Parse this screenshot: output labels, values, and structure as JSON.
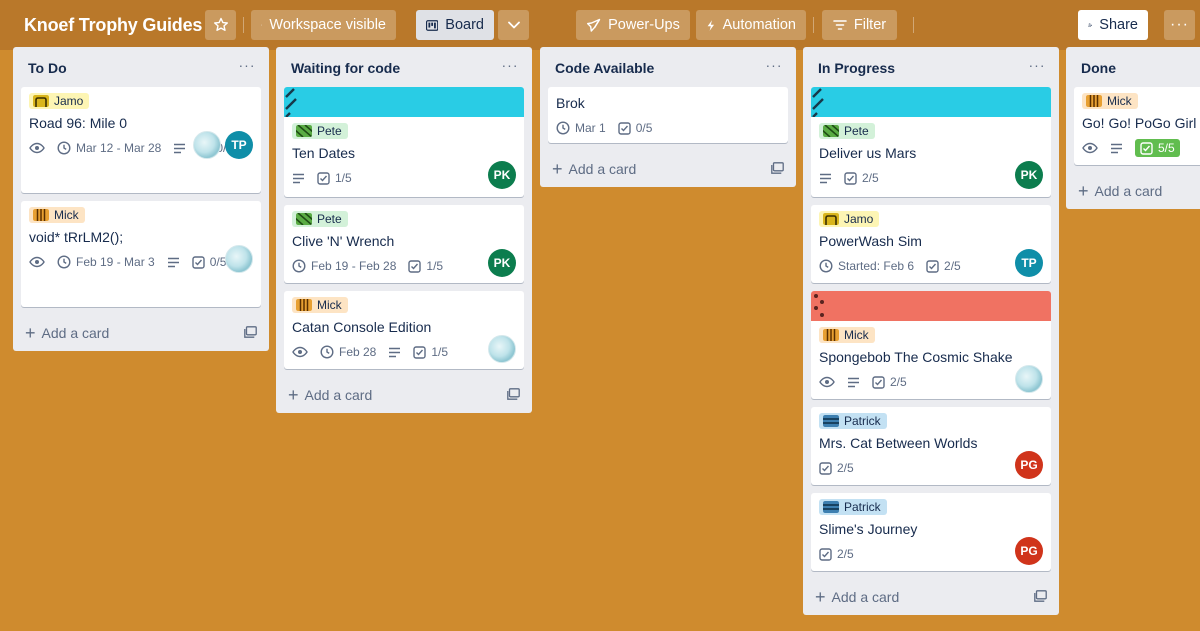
{
  "header": {
    "board_title": "Knoef Trophy Guides",
    "workspace_visible": "Workspace visible",
    "board_view": "Board",
    "power_ups": "Power-Ups",
    "automation": "Automation",
    "filter": "Filter",
    "share": "Share"
  },
  "lists": [
    {
      "title": "To Do",
      "add_card": "Add a card",
      "cards": [
        {
          "label": "Jamo",
          "title": "Road 96: Mile 0",
          "dates": "Mar 12 - Mar 28",
          "checklist": "0/5",
          "members": [
            "avatar-image",
            "TP"
          ]
        },
        {
          "label": "Mick",
          "title": "void* tRrLM2();",
          "dates": "Feb 19 - Mar 3",
          "checklist": "0/5",
          "members": [
            "avatar-image"
          ]
        }
      ]
    },
    {
      "title": "Waiting for code",
      "add_card": "Add a card",
      "cards": [
        {
          "label": "Pete",
          "title": "Ten Dates",
          "checklist": "1/5",
          "members": [
            "PK"
          ]
        },
        {
          "label": "Pete",
          "title": "Clive 'N' Wrench",
          "dates": "Feb 19 - Feb 28",
          "checklist": "1/5",
          "members": [
            "PK"
          ]
        },
        {
          "label": "Mick",
          "title": "Catan Console Edition",
          "dates": "Feb 28",
          "checklist": "1/5",
          "members": [
            "avatar-image"
          ]
        }
      ]
    },
    {
      "title": "Code Available",
      "add_card": "Add a card",
      "cards": [
        {
          "title": "Brok",
          "dates": "Mar 1",
          "checklist": "0/5"
        }
      ]
    },
    {
      "title": "In Progress",
      "add_card": "Add a card",
      "cards": [
        {
          "label": "Pete",
          "title": "Deliver us Mars",
          "checklist": "2/5",
          "members": [
            "PK"
          ]
        },
        {
          "label": "Jamo",
          "title": "PowerWash Sim",
          "dates": "Started: Feb 6",
          "checklist": "2/5",
          "members": [
            "TP"
          ]
        },
        {
          "label": "Mick",
          "title": "Spongebob The Cosmic Shake",
          "checklist": "2/5",
          "members": [
            "avatar-image"
          ]
        },
        {
          "label": "Patrick",
          "title": "Mrs. Cat Between Worlds",
          "checklist": "2/5",
          "members": [
            "PG"
          ]
        },
        {
          "label": "Patrick",
          "title": "Slime's Journey",
          "checklist": "2/5",
          "members": [
            "PG"
          ]
        }
      ]
    },
    {
      "title": "Done",
      "add_card": "Add a card",
      "cards": [
        {
          "label": "Mick",
          "title": "Go! Go! PoGo Girl",
          "checklist": "5/5"
        }
      ]
    }
  ],
  "colors": {
    "board_background": "#cf8b2e",
    "cover_cyan": "#29cce5",
    "cover_red": "#f07262",
    "checklist_complete": "#61bd4f"
  }
}
